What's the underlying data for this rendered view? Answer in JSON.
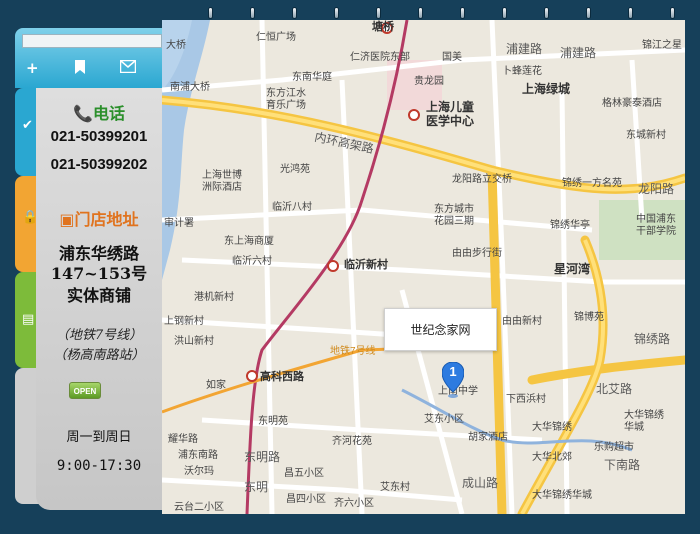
{
  "contact": {
    "phone_heading": "电话",
    "phones": [
      "021-50399201",
      "021-50399202"
    ],
    "store_heading": "门店地址",
    "address_lines": [
      "浦东华绣路",
      "147~153号",
      "实体商铺"
    ],
    "metro_lines": [
      "（地铁7号线）",
      "（杨高南路站）"
    ],
    "open_badge": "OPEN",
    "days": "周一到周日",
    "time": "9:00-17:30"
  },
  "map": {
    "infobox_title": "世纪念家网",
    "marker_number": "1",
    "labels": {
      "l01": "大桥",
      "l02": "仁恒广场",
      "l03": "仁济医院东部",
      "l04": "塘桥",
      "l05": "浦建路",
      "l06": "浦建路",
      "l07": "锦江之星",
      "l08": "东南华庭",
      "l09": "国美",
      "l10": "卜蜂莲花",
      "l11": "上海绿城",
      "l12": "南浦大桥",
      "l13": "东方江水",
      "l14": "育乐广场",
      "l15": "贵龙园",
      "l16": "格林豪泰酒店",
      "l17": "上海儿童",
      "l18": "医学中心",
      "l19": "东城新村",
      "l20": "内环高架路",
      "l21": "上海世博",
      "l22": "洲际酒店",
      "l23": "光鸿苑",
      "l24": "龙阳路立交桥",
      "l25": "锦绣一方名苑",
      "l26": "龙阳路",
      "l27": "东方城市",
      "l28": "花园三期",
      "l29": "中国浦东",
      "l30": "干部学院",
      "l31": "审计署",
      "l32": "临沂八村",
      "l33": "锦绣华亭",
      "l34": "东上海商厦",
      "l35": "由由步行街",
      "l36": "星河湾",
      "l37": "临沂六村",
      "l38": "临沂新村",
      "l39": "港机新村",
      "l40": "由由新村",
      "l41": "锦博苑",
      "l42": "锦绣路",
      "l43": "上钢新村",
      "l44": "洪山新村",
      "l45": "耀华路",
      "l46": "高科西路",
      "l47": "上南中学",
      "l48": "北艾路",
      "l49": "如家",
      "l50": "下西浜村",
      "l51": "大华锦绣",
      "l52": "华城",
      "l53": "艾东小区",
      "l54": "东明苑",
      "l55": "大华锦绣",
      "l56": "齐河花苑",
      "l57": "乐购超市",
      "l58": "东明路",
      "l59": "下南路",
      "l60": "胡家酒店",
      "l61": "大华北郊",
      "l62": "成山路",
      "l63": "昌五小区",
      "l64": "沃尔玛",
      "l65": "艾东村",
      "l66": "云台二小区",
      "l67": "昌四小区",
      "l68": "大华锦绣华城",
      "l69": "齐六小区",
      "l70": "东明",
      "l71": "浦东南路",
      "l72": "地铁7号线"
    }
  },
  "colors": {
    "accent_blue": "#2aa7d1",
    "tab_orange": "#f2a533",
    "tab_green": "#7dbb3a",
    "frame_navy": "#16405a",
    "phone_green": "#2b8f2b",
    "store_orange": "#e0731e"
  }
}
